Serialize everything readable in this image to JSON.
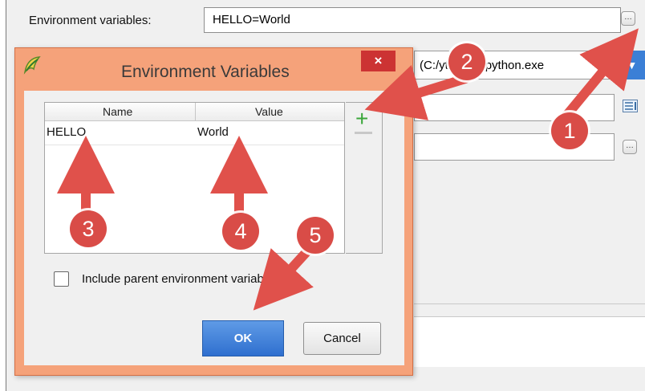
{
  "background": {
    "env_label": "Environment variables:",
    "env_value": "HELLO=World",
    "env_more": "…",
    "interpreter_text": "(C:/ython27/python.exe",
    "combo_arrow": "▼",
    "field_more": "…"
  },
  "dialog": {
    "title": "Environment Variables",
    "close": "×",
    "table": {
      "columns": [
        "Name",
        "Value"
      ],
      "rows": [
        [
          "HELLO",
          "World"
        ]
      ]
    },
    "add_symbol": "+",
    "include_parent_label": "Include parent environment variables",
    "include_parent_checked": false,
    "ok_label": "OK",
    "cancel_label": "Cancel"
  },
  "annotations": [
    "1",
    "2",
    "3",
    "4",
    "5"
  ],
  "colors": {
    "annotation": "#d94c47",
    "dialog_frame": "#f5a27a",
    "ok_button": "#3b7fd6"
  }
}
